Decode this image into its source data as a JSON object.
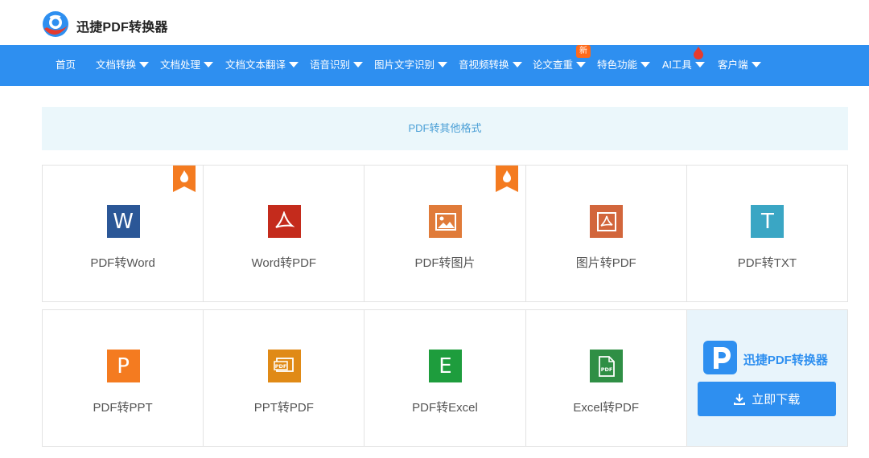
{
  "header": {
    "brand": "迅捷PDF转换器",
    "logo_icon": "app-logo-icon"
  },
  "nav": {
    "items": [
      {
        "label": "首页",
        "dropdown": false
      },
      {
        "label": "文档转换",
        "dropdown": true
      },
      {
        "label": "文档处理",
        "dropdown": true
      },
      {
        "label": "文档文本翻译",
        "dropdown": true
      },
      {
        "label": "语音识别",
        "dropdown": true
      },
      {
        "label": "图片文字识别",
        "dropdown": true
      },
      {
        "label": "音视频转换",
        "dropdown": true
      },
      {
        "label": "论文查重",
        "dropdown": true
      },
      {
        "label": "特色功能",
        "dropdown": true
      },
      {
        "label": "AI工具",
        "dropdown": true
      },
      {
        "label": "客户端",
        "dropdown": true
      }
    ],
    "new_badge": "新"
  },
  "section": {
    "title": "PDF转其他格式"
  },
  "tools_row1": [
    {
      "label": "PDF转Word",
      "icon": "word-icon",
      "glyph": "W",
      "color": "#2b5797",
      "hot": true
    },
    {
      "label": "Word转PDF",
      "icon": "pdf-icon",
      "glyph": "",
      "color": "#c42b1c",
      "hot": false
    },
    {
      "label": "PDF转图片",
      "icon": "image-icon",
      "glyph": "",
      "color": "#e07b39",
      "hot": true
    },
    {
      "label": "图片转PDF",
      "icon": "image-pdf-icon",
      "glyph": "",
      "color": "#d2663c",
      "hot": false
    },
    {
      "label": "PDF转TXT",
      "icon": "txt-icon",
      "glyph": "T",
      "color": "#3aa6c4",
      "hot": false
    }
  ],
  "tools_row2": [
    {
      "label": "PDF转PPT",
      "icon": "ppt-icon",
      "glyph": "P",
      "color": "#f47b20"
    },
    {
      "label": "PPT转PDF",
      "icon": "ppt-pdf-icon",
      "glyph": "",
      "color": "#e08a16"
    },
    {
      "label": "PDF转Excel",
      "icon": "excel-icon",
      "glyph": "E",
      "color": "#1e9d3d"
    },
    {
      "label": "Excel转PDF",
      "icon": "excel-pdf-icon",
      "glyph": "",
      "color": "#2f8f45"
    }
  ],
  "download": {
    "brand": "迅捷PDF转换器",
    "button_label": "立即下载"
  },
  "colors": {
    "primary": "#2e8ff0",
    "banner_bg": "#ebf7fb",
    "hot": "#f47b20"
  }
}
